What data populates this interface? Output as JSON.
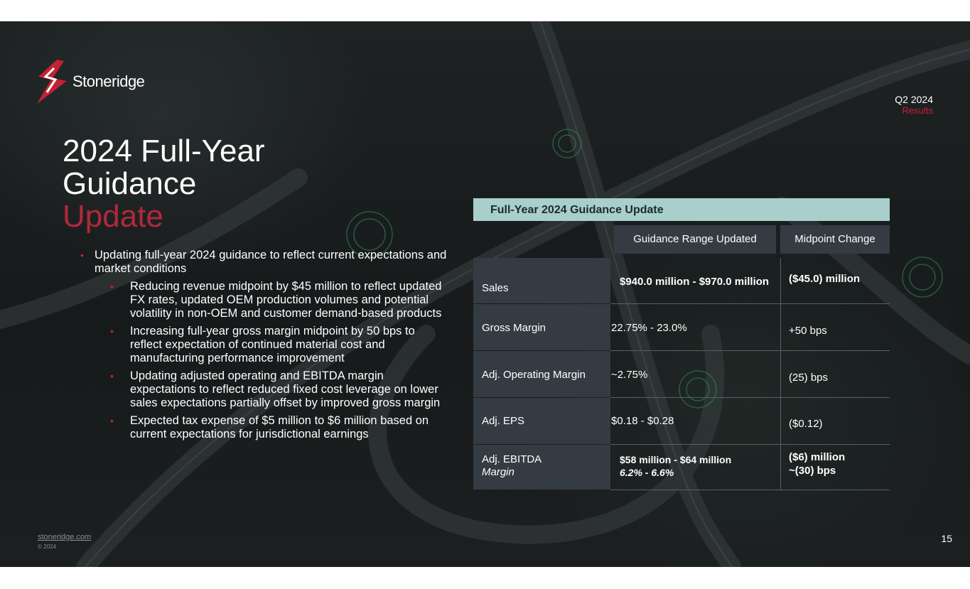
{
  "brand": {
    "name": "Stoneridge",
    "accent_color": "#c42234"
  },
  "corner": {
    "line1": "Q2 2024",
    "line2": "Results"
  },
  "title": {
    "line1": "2024 Full-Year",
    "line2": "Guidance",
    "line3": "Update"
  },
  "bullets": {
    "main": "Updating full-year 2024 guidance to reflect current expectations and market conditions",
    "subs": [
      "Reducing revenue midpoint by $45 million to reflect updated FX rates, updated OEM production volumes and potential volatility in non-OEM and customer demand-based products",
      "Increasing full-year gross margin midpoint by 50 bps to reflect expectation of continued material cost and manufacturing performance improvement",
      "Updating adjusted operating and EBITDA margin expectations to reflect reduced fixed cost leverage on lower sales expectations partially offset by improved gross margin",
      "Expected tax expense of $5 million to $6 million based on current expectations for jurisdictional earnings"
    ]
  },
  "table": {
    "title": "Full-Year 2024 Guidance Update",
    "col1": "Guidance Range Updated",
    "col2": "Midpoint Change",
    "rows": [
      {
        "label": "Sales",
        "range": "$940.0 million - $970.0 million",
        "change": "($45.0) million"
      },
      {
        "label": "Gross Margin",
        "range": "22.75% - 23.0%",
        "change": "+50 bps"
      },
      {
        "label": "Adj. Operating Margin",
        "range": "~2.75%",
        "change": "(25) bps"
      },
      {
        "label": "Adj. EPS",
        "range": "$0.18 - $0.28",
        "change": "($0.12)"
      },
      {
        "label": "Adj. EBITDA",
        "label_sub": "Margin",
        "range": "$58 million - $64 million",
        "range_sub": "6.2% - 6.6%",
        "change": "($6) million",
        "change_sub": "~(30) bps"
      }
    ]
  },
  "footer": {
    "link": "stoneridge.com",
    "copyright": "© 2024",
    "page": "15"
  }
}
